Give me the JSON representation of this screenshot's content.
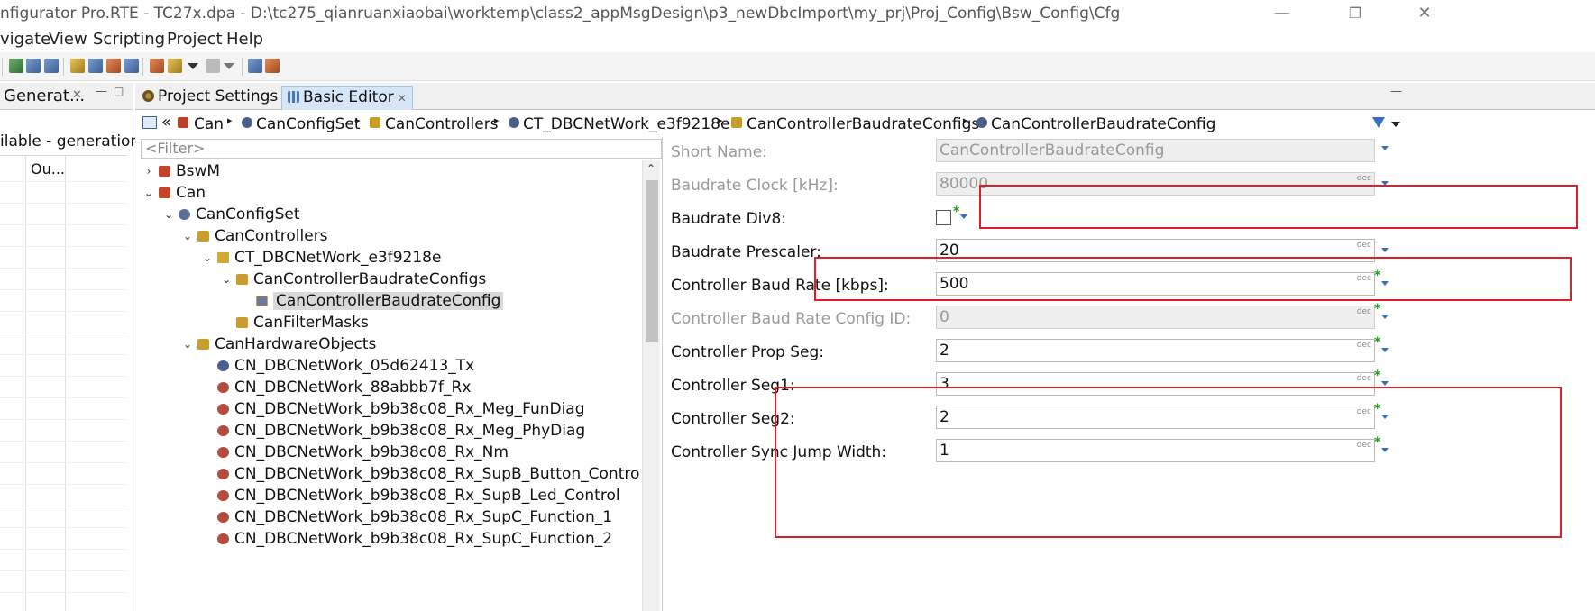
{
  "window": {
    "title": "nfigurator Pro.RTE - TC27x.dpa - D:\\tc275_qianruanxiaobai\\worktemp\\class2_appMsgDesign\\p3_newDbcImport\\my_prj\\Proj_Config\\Bsw_Config\\Cfg",
    "minimize_glyph": "—",
    "maximize_glyph": "❐",
    "close_glyph": "✕"
  },
  "menu": {
    "items": [
      "vigate",
      "View",
      "Scripting",
      "Project",
      "Help"
    ]
  },
  "left_view": {
    "tab_label": "Generat...",
    "close_glyph": "✕",
    "minimize_glyph": "—",
    "maximize_glyph": "□",
    "status_text": "ilable - generation",
    "column_header": "Ou..."
  },
  "editor": {
    "tabs": [
      {
        "label": "Project Settings",
        "icon": "gear-icon",
        "active": false
      },
      {
        "label": "Basic Editor",
        "icon": "grid-icon",
        "active": true,
        "close_glyph": "✕"
      }
    ],
    "view_minimize_glyph": "—"
  },
  "breadcrumb": {
    "back_glyph": "«",
    "items": [
      {
        "label": "Can",
        "icon": "can-module-icon"
      },
      {
        "label": "CanConfigSet",
        "icon": "container-icon"
      },
      {
        "label": "CanControllers",
        "icon": "folder-icon"
      },
      {
        "label": "CT_DBCNetWork_e3f9218e",
        "icon": "container-icon"
      },
      {
        "label": "CanControllerBaudrateConfigs",
        "icon": "folder-icon"
      },
      {
        "label": "CanControllerBaudrateConfig",
        "icon": "container-icon"
      }
    ],
    "separator": "▸"
  },
  "tree": {
    "filter_placeholder": "<Filter>",
    "nodes": [
      {
        "label": "BswM",
        "level": 0,
        "toggle": "›",
        "icon": "bswm"
      },
      {
        "label": "Can",
        "level": 0,
        "toggle": "⌄",
        "icon": "can"
      },
      {
        "label": "CanConfigSet",
        "level": 1,
        "toggle": "⌄",
        "icon": "set"
      },
      {
        "label": "CanControllers",
        "level": 2,
        "toggle": "⌄",
        "icon": "ctr"
      },
      {
        "label": "CT_DBCNetWork_e3f9218e",
        "level": 3,
        "toggle": "⌄",
        "icon": "ct"
      },
      {
        "label": "CanControllerBaudrateConfigs",
        "level": 4,
        "toggle": "⌄",
        "icon": "cbr"
      },
      {
        "label": "CanControllerBaudrateConfig",
        "level": 5,
        "toggle": "",
        "icon": "cbc",
        "selected": true
      },
      {
        "label": "CanFilterMasks",
        "level": 4,
        "toggle": "",
        "icon": "cbr"
      },
      {
        "label": "CanHardwareObjects",
        "level": 2,
        "toggle": "⌄",
        "icon": "ctr"
      },
      {
        "label": "CN_DBCNetWork_05d62413_Tx",
        "level": 3,
        "toggle": "",
        "icon": "tx"
      },
      {
        "label": "CN_DBCNetWork_88abbb7f_Rx",
        "level": 3,
        "toggle": "",
        "icon": "rx"
      },
      {
        "label": "CN_DBCNetWork_b9b38c08_Rx_Meg_FunDiag",
        "level": 3,
        "toggle": "",
        "icon": "rx"
      },
      {
        "label": "CN_DBCNetWork_b9b38c08_Rx_Meg_PhyDiag",
        "level": 3,
        "toggle": "",
        "icon": "rx"
      },
      {
        "label": "CN_DBCNetWork_b9b38c08_Rx_Nm",
        "level": 3,
        "toggle": "",
        "icon": "rx"
      },
      {
        "label": "CN_DBCNetWork_b9b38c08_Rx_SupB_Button_Control",
        "level": 3,
        "toggle": "",
        "icon": "rx"
      },
      {
        "label": "CN_DBCNetWork_b9b38c08_Rx_SupB_Led_Control",
        "level": 3,
        "toggle": "",
        "icon": "rx"
      },
      {
        "label": "CN_DBCNetWork_b9b38c08_Rx_SupC_Function_1",
        "level": 3,
        "toggle": "",
        "icon": "rx"
      },
      {
        "label": "CN_DBCNetWork_b9b38c08_Rx_SupC_Function_2",
        "level": 3,
        "toggle": "",
        "icon": "rx"
      }
    ],
    "scroll_up_glyph": "⌃"
  },
  "properties": {
    "short_name": {
      "label": "Short Name:",
      "value": "CanControllerBaudrateConfig",
      "disabled": true
    },
    "baudrate_clock": {
      "label": "Baudrate Clock [kHz]:",
      "value": "80000",
      "disabled": true,
      "unit_tag": "dec"
    },
    "baudrate_div8": {
      "label": "Baudrate Div8:",
      "checked": false,
      "star": "*"
    },
    "baudrate_prescaler": {
      "label": "Baudrate Prescaler:",
      "value": "20",
      "unit_tag": "dec"
    },
    "controller_baud_rate": {
      "label": "Controller Baud Rate [kbps]:",
      "value": "500",
      "unit_tag": "dec",
      "star": "*"
    },
    "controller_baud_rate_config_id": {
      "label": "Controller Baud Rate Config ID:",
      "value": "0",
      "disabled": true,
      "unit_tag": "dec",
      "star": "*"
    },
    "controller_prop_seg": {
      "label": "Controller Prop Seg:",
      "value": "2",
      "unit_tag": "dec",
      "star": "*"
    },
    "controller_seg1": {
      "label": "Controller Seg1:",
      "value": "3",
      "unit_tag": "dec",
      "star": "*"
    },
    "controller_seg2": {
      "label": "Controller Seg2:",
      "value": "2",
      "unit_tag": "dec",
      "star": "*"
    },
    "controller_sync_jump_width": {
      "label": "Controller Sync Jump Width:",
      "value": "1",
      "unit_tag": "dec",
      "star": "*"
    }
  },
  "colors": {
    "highlight_red": "#e01e2a",
    "selection_gray": "#d9d9d9",
    "active_tab": "#d7e6f7",
    "modified_star": "#1e9a1e"
  }
}
